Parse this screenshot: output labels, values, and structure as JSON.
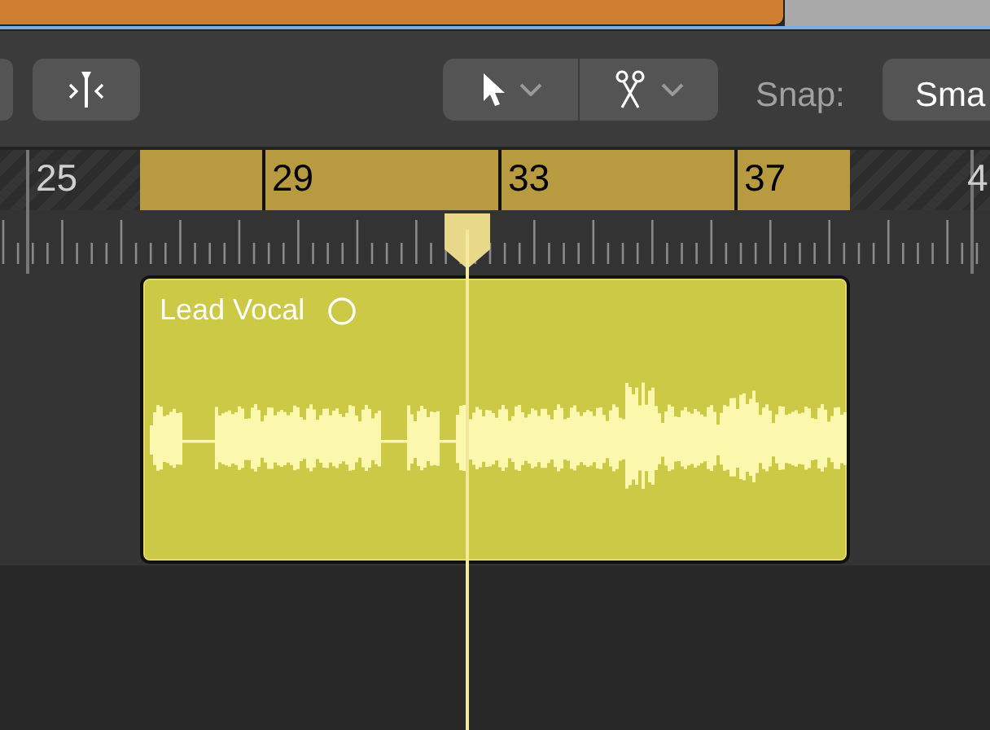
{
  "toolbar": {
    "snap_label": "Snap:",
    "snap_value": "Sma"
  },
  "ruler": {
    "bars": [
      "25",
      "29",
      "33",
      "37",
      "4"
    ]
  },
  "region": {
    "name": "Lead Vocal"
  }
}
